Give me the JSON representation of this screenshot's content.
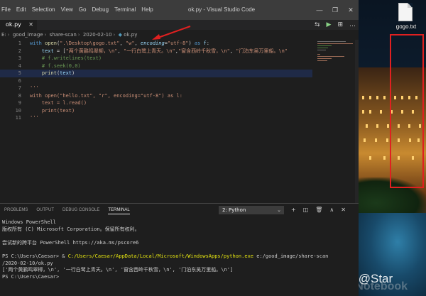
{
  "window": {
    "title": "ok.py - Visual Studio Code",
    "menu": [
      "File",
      "Edit",
      "Selection",
      "View",
      "Go",
      "Debug",
      "Terminal",
      "Help"
    ],
    "controls": [
      "—",
      "❐",
      "✕"
    ]
  },
  "tab": {
    "label": "ok.py",
    "close": "✕"
  },
  "breadcrumb": [
    "E:",
    "good_image",
    "share-scan",
    "2020-02-10",
    "ok.py"
  ],
  "tab_actions": [
    "⇆",
    "▶",
    "⊞",
    "…"
  ],
  "editor": {
    "lines": [
      {
        "n": "1",
        "html": "<span class=\"kw\">with</span> <span class=\"fn\">open</span>(<span class=\"str\">\".\\Desktop\\gogo.txt\"</span>, <span class=\"str\">\"w\"</span>, <span class=\"param\">encoding</span>=<span class=\"str\">\"utf-8\"</span>) <span class=\"kw\">as</span> <span class=\"var\">f</span>:"
      },
      {
        "n": "2",
        "html": "    <span class=\"var\">text</span> = [<span class=\"str\">\"两个黄鹂鸣翠柳，\\n\"</span>, <span class=\"str\">\"一行白鹭上青天。\\n\"</span>,<span class=\"str\">\"窗含西岭千秋雪，\\n\"</span>, <span class=\"str\">\"门泊东吴万里船。\\n\"</span>"
      },
      {
        "n": "3",
        "html": "    <span class=\"cm\"># f.writelines(text)</span>"
      },
      {
        "n": "4",
        "html": "    <span class=\"cm\"># f.seek(0,0)</span>"
      },
      {
        "n": "5",
        "html": "    <span class=\"fn\">print</span>(<span class=\"var\">text</span>)"
      },
      {
        "n": "6",
        "html": ""
      },
      {
        "n": "7",
        "html": "<span class=\"str\">'''</span>"
      },
      {
        "n": "8",
        "html": "<span class=\"str\">with open(\"hello.txt\", \"r\", encoding=\"utf-8\") as l:</span>"
      },
      {
        "n": "9",
        "html": "<span class=\"str\">    text = l.read()</span>"
      },
      {
        "n": "10",
        "html": "<span class=\"str\">    print(text)</span>"
      },
      {
        "n": "11",
        "html": "<span class=\"str\">'''</span>"
      }
    ],
    "active_line": 5
  },
  "panel": {
    "tabs": [
      "PROBLEMS",
      "OUTPUT",
      "DEBUG CONSOLE",
      "TERMINAL"
    ],
    "active_tab": "TERMINAL",
    "terminal_select": "2: Python",
    "actions": [
      "+",
      "◫",
      "🗑",
      "∧",
      "✕"
    ],
    "terminal_lines": [
      "Windows PowerShell",
      "版权所有 (C) Microsoft Corporation。保留所有权利。",
      "",
      "尝试新的跨平台 PowerShell https://aka.ms/pscore6",
      "",
      "PS C:\\Users\\Caesar> & C:/Users/Caesar/AppData/Local/Microsoft/WindowsApps/python.exe e:/good_image/share-scan",
      "/2020-02-10/ok.py",
      "['两个黄鹂鸣翠柳，\\n', '一行白鹭上青天。\\n', '窗含西岭千秋雪，\\n', '门泊东吴万里船。\\n']",
      "PS C:\\Users\\Caesar>"
    ]
  },
  "desktop": {
    "file_icon_label": "gogo.txt",
    "watermark": "知乎 @Star",
    "watermark2": "Star's Notebook",
    "highlight_color": "#e02020"
  }
}
